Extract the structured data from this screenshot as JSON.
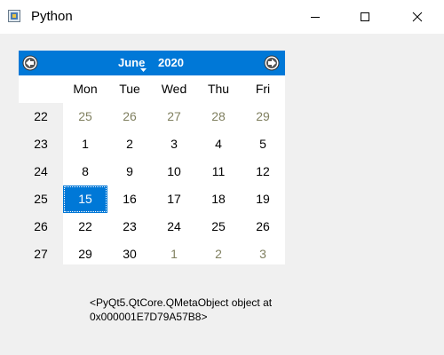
{
  "window": {
    "title": "Python",
    "icon": "python-app-icon",
    "controls": [
      "minimize-icon",
      "maximize-icon",
      "close-icon"
    ]
  },
  "calendar": {
    "month": "June",
    "year": "2020",
    "accent_color": "#0078d7",
    "other_month_color": "#808060",
    "day_headers": [
      "Mon",
      "Tue",
      "Wed",
      "Thu",
      "Fri"
    ],
    "weeks": [
      {
        "number": "22",
        "days": [
          {
            "d": "25",
            "other": true
          },
          {
            "d": "26",
            "other": true
          },
          {
            "d": "27",
            "other": true
          },
          {
            "d": "28",
            "other": true
          },
          {
            "d": "29",
            "other": true
          }
        ]
      },
      {
        "number": "23",
        "days": [
          {
            "d": "1"
          },
          {
            "d": "2"
          },
          {
            "d": "3"
          },
          {
            "d": "4"
          },
          {
            "d": "5"
          }
        ]
      },
      {
        "number": "24",
        "days": [
          {
            "d": "8"
          },
          {
            "d": "9"
          },
          {
            "d": "10"
          },
          {
            "d": "11"
          },
          {
            "d": "12"
          }
        ]
      },
      {
        "number": "25",
        "days": [
          {
            "d": "15",
            "selected": true
          },
          {
            "d": "16"
          },
          {
            "d": "17"
          },
          {
            "d": "18"
          },
          {
            "d": "19"
          }
        ]
      },
      {
        "number": "26",
        "days": [
          {
            "d": "22"
          },
          {
            "d": "23"
          },
          {
            "d": "24"
          },
          {
            "d": "25"
          },
          {
            "d": "26"
          }
        ]
      },
      {
        "number": "27",
        "days": [
          {
            "d": "29"
          },
          {
            "d": "30"
          },
          {
            "d": "1",
            "other": true
          },
          {
            "d": "2",
            "other": true
          },
          {
            "d": "3",
            "other": true
          }
        ]
      }
    ]
  },
  "label": {
    "text": "<PyQt5.QtCore.QMetaObject object at\n0x000001E7D79A57B8>"
  }
}
